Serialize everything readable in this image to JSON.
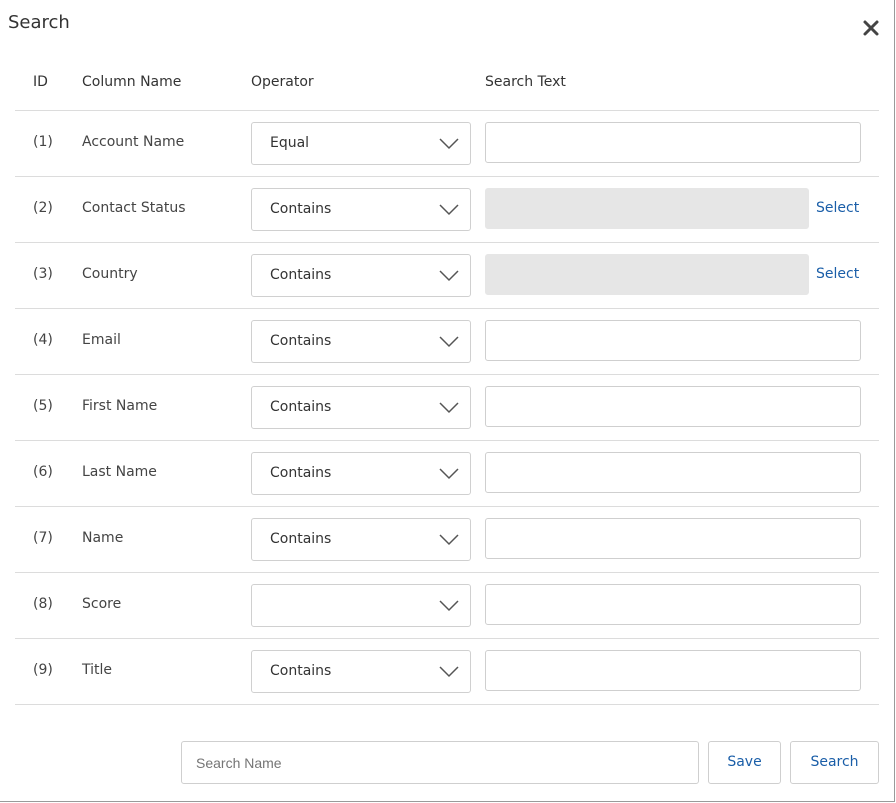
{
  "dialog": {
    "title": "Search",
    "close_icon": "close-icon"
  },
  "columns": {
    "id": "ID",
    "column_name": "Column Name",
    "operator": "Operator",
    "search_text": "Search Text"
  },
  "rows": [
    {
      "id": "(1)",
      "name": "Account Name",
      "operator": "Equal",
      "text": "",
      "disabled": false,
      "select_label": ""
    },
    {
      "id": "(2)",
      "name": "Contact Status",
      "operator": "Contains",
      "text": "",
      "disabled": true,
      "select_label": "Select"
    },
    {
      "id": "(3)",
      "name": "Country",
      "operator": "Contains",
      "text": "",
      "disabled": true,
      "select_label": "Select"
    },
    {
      "id": "(4)",
      "name": "Email",
      "operator": "Contains",
      "text": "",
      "disabled": false,
      "select_label": ""
    },
    {
      "id": "(5)",
      "name": "First Name",
      "operator": "Contains",
      "text": "",
      "disabled": false,
      "select_label": ""
    },
    {
      "id": "(6)",
      "name": "Last Name",
      "operator": "Contains",
      "text": "",
      "disabled": false,
      "select_label": ""
    },
    {
      "id": "(7)",
      "name": "Name",
      "operator": "Contains",
      "text": "",
      "disabled": false,
      "select_label": ""
    },
    {
      "id": "(8)",
      "name": "Score",
      "operator": "",
      "text": "",
      "disabled": false,
      "select_label": ""
    },
    {
      "id": "(9)",
      "name": "Title",
      "operator": "Contains",
      "text": "",
      "disabled": false,
      "select_label": ""
    }
  ],
  "footer": {
    "search_name_placeholder": "Search Name",
    "save_label": "Save",
    "search_label": "Search"
  },
  "colors": {
    "link": "#1a5ea8",
    "disabled_field": "#e6e6e6",
    "divider": "#dcdcdc"
  }
}
